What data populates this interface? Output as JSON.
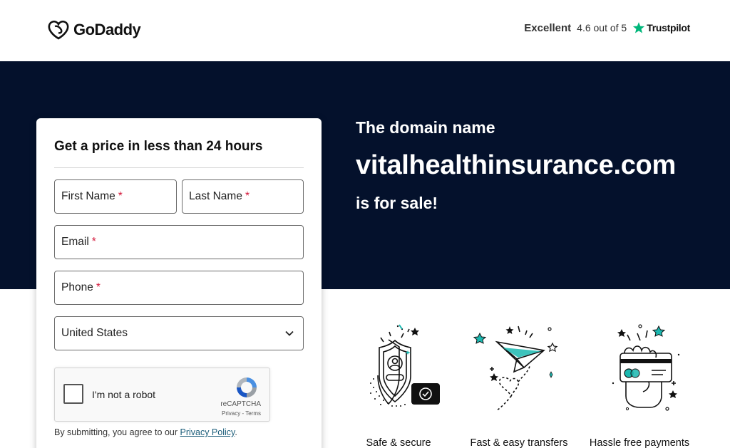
{
  "header": {
    "brand": "GoDaddy",
    "rating_word": "Excellent",
    "rating_score": "4.6 out of 5",
    "rating_provider": "Trustpilot"
  },
  "hero": {
    "line1": "The domain name",
    "domain": "vitalhealthinsurance.com",
    "line3": "is for sale!"
  },
  "form": {
    "title": "Get a price in less than 24 hours",
    "first_name_label": "First Name",
    "last_name_label": "Last Name",
    "email_label": "Email",
    "phone_label": "Phone",
    "required_mark": "*",
    "country_value": "United States",
    "recaptcha": {
      "label": "I'm not a robot",
      "brand": "reCAPTCHA",
      "privacy": "Privacy",
      "separator": " - ",
      "terms": "Terms"
    },
    "disclaimer_prefix": "By submitting, you agree to our ",
    "disclaimer_link": "Privacy Policy",
    "disclaimer_suffix": "."
  },
  "features": [
    {
      "label": "Safe & secure",
      "icon": "shield-icon"
    },
    {
      "label": "Fast & easy transfers",
      "icon": "paper-plane-icon"
    },
    {
      "label": "Hassle free payments",
      "icon": "card-hand-icon"
    }
  ],
  "colors": {
    "hero_bg": "#04112c",
    "required": "#d4183b",
    "teal_accent": "#1bb8b0",
    "trustpilot_green": "#00b67a",
    "link": "#1b5d7a"
  }
}
